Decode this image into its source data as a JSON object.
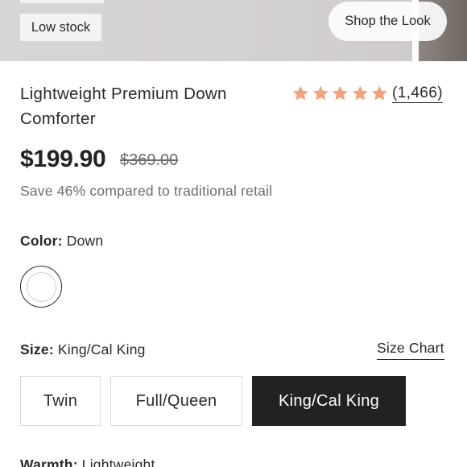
{
  "hero": {
    "badge": "Low stock",
    "shop_the_look": "Shop the Look"
  },
  "product": {
    "title_line1": "Lightweight Premium Down",
    "title_line2": "Comforter",
    "rating_value": 5,
    "review_count": "(1,466)",
    "star_color": "#f4a27a",
    "price": "$199.90",
    "compare_price": "$369.00",
    "savings": "Save 46% compared to traditional retail"
  },
  "color_option": {
    "label": "Color:",
    "value": "Down",
    "swatch_color": "#ffffff"
  },
  "size_option": {
    "label": "Size:",
    "value": "King/Cal King",
    "size_chart": "Size Chart",
    "choices": [
      "Twin",
      "Full/Queen",
      "King/Cal King"
    ],
    "selected": "King/Cal King"
  },
  "warmth_option": {
    "label": "Warmth:",
    "value": "Lightweight"
  }
}
